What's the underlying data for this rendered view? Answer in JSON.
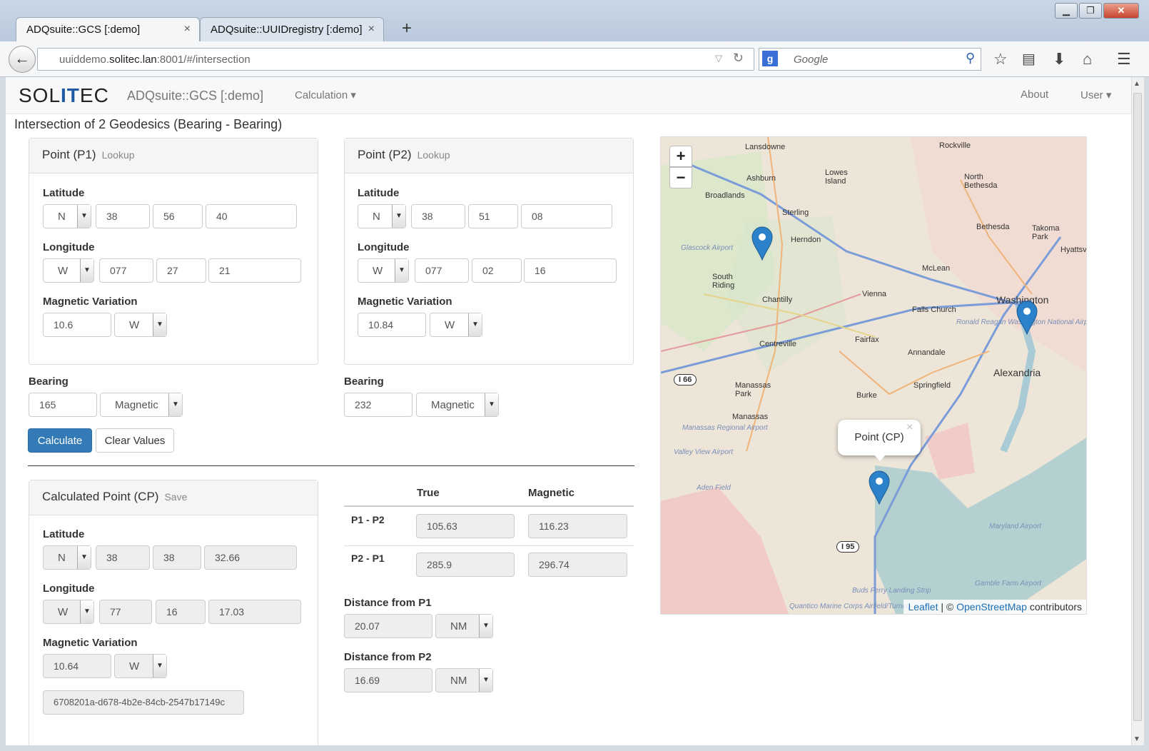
{
  "browser": {
    "tabs": [
      {
        "label": "ADQsuite::GCS [:demo]"
      },
      {
        "label": "ADQsuite::UUIDregistry [:demo]"
      }
    ],
    "url_prefix": "uuiddemo.",
    "url_host": "solitec.lan",
    "url_suffix": ":8001/#/intersection",
    "search_placeholder": "Google",
    "new_tab": "+",
    "close_tab": "×",
    "back": "←"
  },
  "app": {
    "logo_left": "SOL",
    "logo_mid": "IT",
    "logo_right": "EC",
    "title": "ADQsuite::GCS [:demo]",
    "menu_calculation": "Calculation ▾",
    "menu_about": "About",
    "menu_user": "User ▾"
  },
  "page_title": "Intersection of 2 Geodesics (Bearing - Bearing)",
  "labels": {
    "latitude": "Latitude",
    "longitude": "Longitude",
    "magnetic_variation": "Magnetic Variation",
    "bearing": "Bearing",
    "lookup": "Lookup",
    "save": "Save"
  },
  "p1": {
    "title": "Point (P1)",
    "lat_hemi": "N",
    "lat_deg": "38",
    "lat_min": "56",
    "lat_sec": "40",
    "lon_hemi": "W",
    "lon_deg": "077",
    "lon_min": "27",
    "lon_sec": "21",
    "magvar": "10.6",
    "magvar_dir": "W",
    "bearing": "165",
    "bearing_type": "Magnetic"
  },
  "p2": {
    "title": "Point (P2)",
    "lat_hemi": "N",
    "lat_deg": "38",
    "lat_min": "51",
    "lat_sec": "08",
    "lon_hemi": "W",
    "lon_deg": "077",
    "lon_min": "02",
    "lon_sec": "16",
    "magvar": "10.84",
    "magvar_dir": "W",
    "bearing": "232",
    "bearing_type": "Magnetic"
  },
  "buttons": {
    "calculate": "Calculate",
    "clear": "Clear Values"
  },
  "cp": {
    "title": "Calculated Point (CP)",
    "lat_hemi": "N",
    "lat_deg": "38",
    "lat_min": "38",
    "lat_sec": "32.66",
    "lon_hemi": "W",
    "lon_deg": "77",
    "lon_min": "16",
    "lon_sec": "17.03",
    "magvar": "10.64",
    "magvar_dir": "W",
    "uuid": "6708201a-d678-4b2e-84cb-2547b17149c"
  },
  "results": {
    "col_true": "True",
    "col_magnetic": "Magnetic",
    "rows": [
      {
        "label": "P1 - P2",
        "true": "105.63",
        "magnetic": "116.23"
      },
      {
        "label": "P2 - P1",
        "true": "285.9",
        "magnetic": "296.74"
      }
    ],
    "dist_p1_label": "Distance from P1",
    "dist_p1": "20.07",
    "dist_p1_unit": "NM",
    "dist_p2_label": "Distance from P2",
    "dist_p2": "16.69",
    "dist_p2_unit": "NM"
  },
  "map": {
    "zoom_in": "+",
    "zoom_out": "−",
    "popup": "Point (CP)",
    "popup_close": "×",
    "attrib_leaflet": "Leaflet",
    "attrib_sep": "| ©",
    "attrib_osm": "OpenStreetMap",
    "attrib_rest": "contributors",
    "places": [
      "Lansdowne",
      "Rockville",
      "Ashburn",
      "Lowes Island",
      "North Bethesda",
      "Broadlands",
      "Sterling",
      "Herndon",
      "Bethesda",
      "Takoma Park",
      "Glascock Airport",
      "South Riding",
      "McLean",
      "Hyattsville",
      "Chantilly",
      "Vienna",
      "Falls Church",
      "Washington",
      "Ronald Reagan Washington National Airport",
      "Fairfax",
      "Centreville",
      "Annandale",
      "Alexandria",
      "I 66",
      "Manassas Park",
      "Burke",
      "Springfield",
      "Manassas",
      "Manassas Regional Airport",
      "Valley View Airport",
      "Aden Field",
      "I 95",
      "Maryland Airport",
      "Quantico Marine Corps Airfield/Turner",
      "Buds Ferry Landing Strip",
      "Gamble Farm Airport",
      "Washington"
    ]
  },
  "colors": {
    "primary": "#337ab7",
    "marker": "#2b82cb",
    "logo_accent": "#1f5aa6"
  }
}
